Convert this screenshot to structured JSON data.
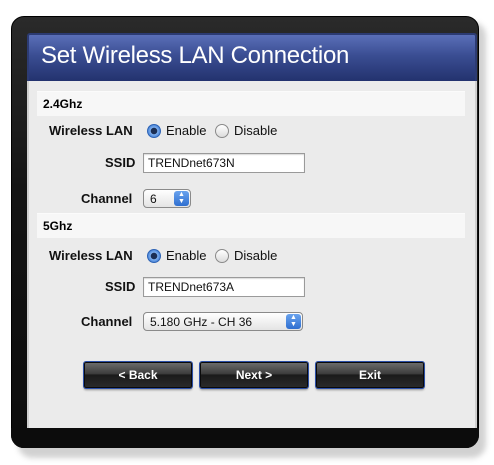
{
  "title": "Set Wireless LAN Connection",
  "band24": {
    "header": "2.4Ghz",
    "wireless_lan_label": "Wireless LAN",
    "enable_label": "Enable",
    "disable_label": "Disable",
    "wireless_lan_selected": "Enable",
    "ssid_label": "SSID",
    "ssid_value": "TRENDnet673N",
    "channel_label": "Channel",
    "channel_value": "6"
  },
  "band5": {
    "header": "5Ghz",
    "wireless_lan_label": "Wireless LAN",
    "enable_label": "Enable",
    "disable_label": "Disable",
    "wireless_lan_selected": "Enable",
    "ssid_label": "SSID",
    "ssid_value": "TRENDnet673A",
    "channel_label": "Channel",
    "channel_value": "5.180 GHz - CH 36"
  },
  "buttons": {
    "back": "< Back",
    "next": "Next >",
    "exit": "Exit"
  },
  "colors": {
    "title_bar": "#3a4d92",
    "frame": "#141414",
    "panel": "#ebebeb",
    "radio_selected": "#3c78d0"
  }
}
